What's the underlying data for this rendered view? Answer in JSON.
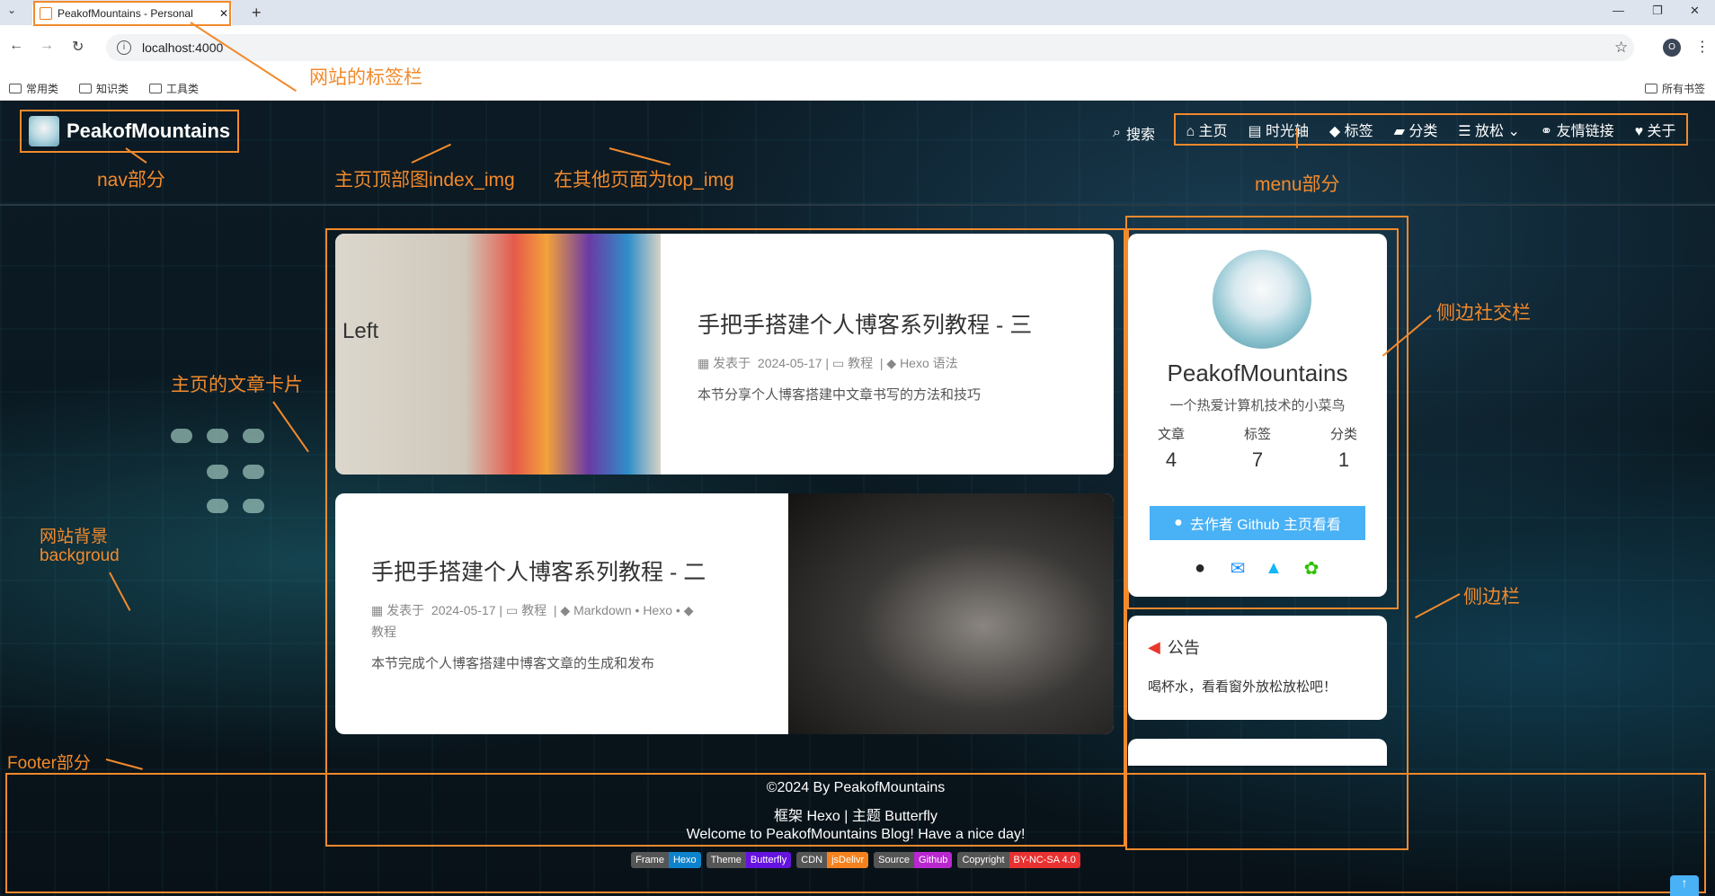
{
  "browser": {
    "tab_title": "PeakofMountains - Personal",
    "url": "localhost:4000",
    "profile_initial": "O",
    "bookmarks": [
      "常用类",
      "知识类",
      "工具类"
    ],
    "bookmarks_right": "所有书签"
  },
  "nav": {
    "site_title": "PeakofMountains",
    "search": "搜索",
    "menu": [
      "主页",
      "时光轴",
      "标签",
      "分类",
      "放松",
      "友情链接",
      "关于"
    ]
  },
  "posts": [
    {
      "title": "手把手搭建个人博客系列教程 - 三",
      "meta_prefix": "发表于",
      "date": "2024-05-17",
      "category": "教程",
      "tags": "Hexo 语法",
      "desc": "本节分享个人博客搭建中文章书写的方法和技巧",
      "cover_text": "Left"
    },
    {
      "title": "手把手搭建个人博客系列教程 - 二",
      "meta_prefix": "发表于",
      "date": "2024-05-17",
      "category": "教程",
      "tags": "Markdown • Hexo •",
      "tags2": "教程",
      "desc": "本节完成个人博客搭建中博客文章的生成和发布"
    }
  ],
  "sidebar": {
    "author_name": "PeakofMountains",
    "author_desc": "一个热爱计算机技术的小菜鸟",
    "stats": [
      {
        "label": "文章",
        "value": "4"
      },
      {
        "label": "标签",
        "value": "7"
      },
      {
        "label": "分类",
        "value": "1"
      }
    ],
    "github_button": "去作者 Github 主页看看",
    "announcement_title": "公告",
    "announcement_text": "喝杯水，看看窗外放松放松吧！"
  },
  "footer": {
    "copyright": "©2024 By PeakofMountains",
    "framework": "框架 Hexo |  主题 Butterfly",
    "welcome": "Welcome to PeakofMountains Blog! Have a nice day!",
    "badges": [
      {
        "left": "Frame",
        "right": "Hexo",
        "color": "#0e83cd"
      },
      {
        "left": "Theme",
        "right": "Butterfly",
        "color": "#6513df"
      },
      {
        "left": "CDN",
        "right": "jsDelivr",
        "color": "#f5821f"
      },
      {
        "left": "Source",
        "right": "Github",
        "color": "#b927cf"
      },
      {
        "left": "Copyright",
        "right": "BY-NC-SA 4.0",
        "color": "#e83131"
      }
    ]
  },
  "annotations": {
    "tab_bar": "网站的标签栏",
    "nav_part": "nav部分",
    "index_img": "主页顶部图index_img",
    "top_img": "在其他页面为top_img",
    "menu_part": "menu部分",
    "social_bar": "侧边社交栏",
    "article_card": "主页的文章卡片",
    "background": "网站背景",
    "background_en": "backgroud",
    "sidebar": "侧边栏",
    "footer_part": "Footer部分"
  }
}
